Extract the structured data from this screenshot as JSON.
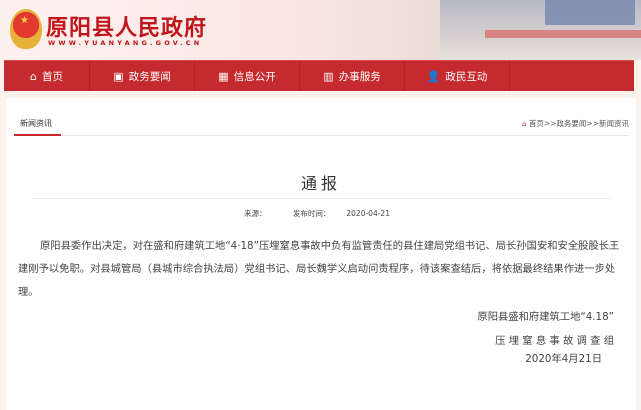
{
  "header": {
    "site_title": "原阳县人民政府",
    "site_url": "WWW.YUANYANG.GOV.CN",
    "emblem": "national-emblem"
  },
  "nav": [
    {
      "label": "首页",
      "icon": "home-icon"
    },
    {
      "label": "政务要闻",
      "icon": "news-icon"
    },
    {
      "label": "信息公开",
      "icon": "info-icon"
    },
    {
      "label": "办事服务",
      "icon": "building-icon"
    },
    {
      "label": "政民互动",
      "icon": "user-icon"
    }
  ],
  "tab": "新闻资讯",
  "breadcrumb": {
    "home": "首页",
    "sep": ">>",
    "section": "政务要闻",
    "current": "新闻资讯"
  },
  "article": {
    "title": "通报",
    "source_label": "来源：",
    "date_label": "发布时间：",
    "date": "2020-04-21",
    "body": "原阳县委作出决定，对在盛和府建筑工地“4·18”压埋窒息事故中负有监管责任的县住建局党组书记、局长孙国安和安全股股长王建刚予以免职。对县城管局（县城市综合执法局）党组书记、局长魏学义启动问责程序，待该案查结后，将依据最终结果作进一步处理。",
    "sign_line1": "原阳县盛和府建筑工地“4.18”",
    "sign_line2": "压 埋 窒 息 事 故 调 查 组",
    "sign_date": "2020年4月21日"
  },
  "colors": {
    "brand": "#c52a2e",
    "background": "#fbf3ec"
  }
}
